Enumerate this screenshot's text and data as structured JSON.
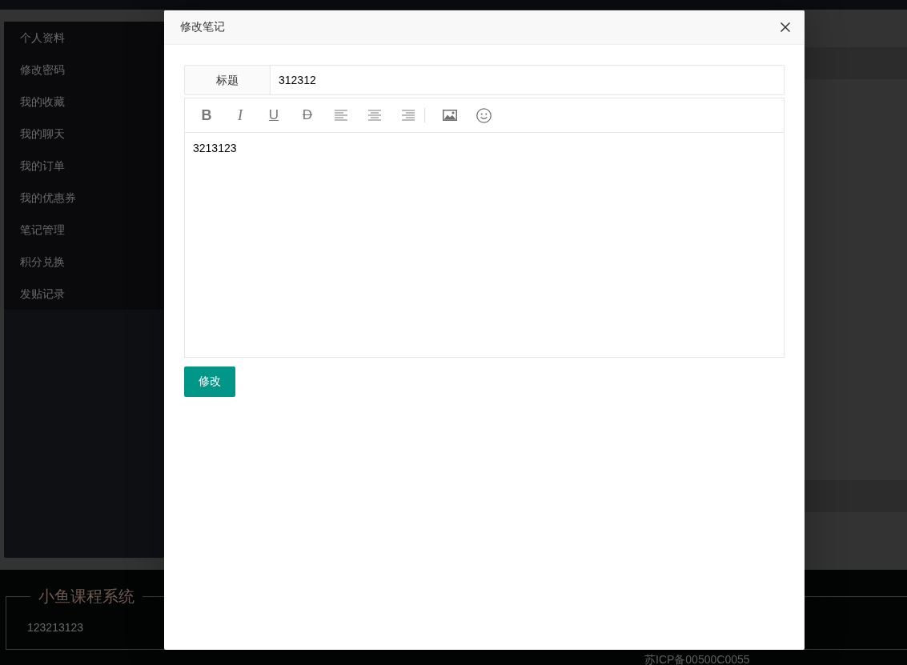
{
  "sidebar": {
    "items": [
      {
        "label": "个人资料"
      },
      {
        "label": "修改密码"
      },
      {
        "label": "我的收藏"
      },
      {
        "label": "我的聊天"
      },
      {
        "label": "我的订单"
      },
      {
        "label": "我的优惠券"
      },
      {
        "label": "笔记管理"
      },
      {
        "label": "积分兑换"
      },
      {
        "label": "发贴记录"
      }
    ]
  },
  "footer": {
    "title": "小鱼课程系统",
    "text": "123213123",
    "icp": "苏ICP备00500C0055"
  },
  "dialog": {
    "title": "修改笔记",
    "fields": [
      {
        "label": "标题",
        "value": "312312"
      }
    ],
    "editor": {
      "toolbar": [
        {
          "kind": "bold",
          "label": "B"
        },
        {
          "kind": "italic",
          "label": "I"
        },
        {
          "kind": "underline",
          "label": "U"
        },
        {
          "kind": "strike",
          "label": "D"
        },
        {
          "kind": "align-left"
        },
        {
          "kind": "align-center"
        },
        {
          "kind": "align-right"
        },
        {
          "kind": "divider"
        },
        {
          "kind": "image"
        },
        {
          "kind": "emoji"
        }
      ],
      "content": "3213123"
    },
    "submit": "修改"
  }
}
